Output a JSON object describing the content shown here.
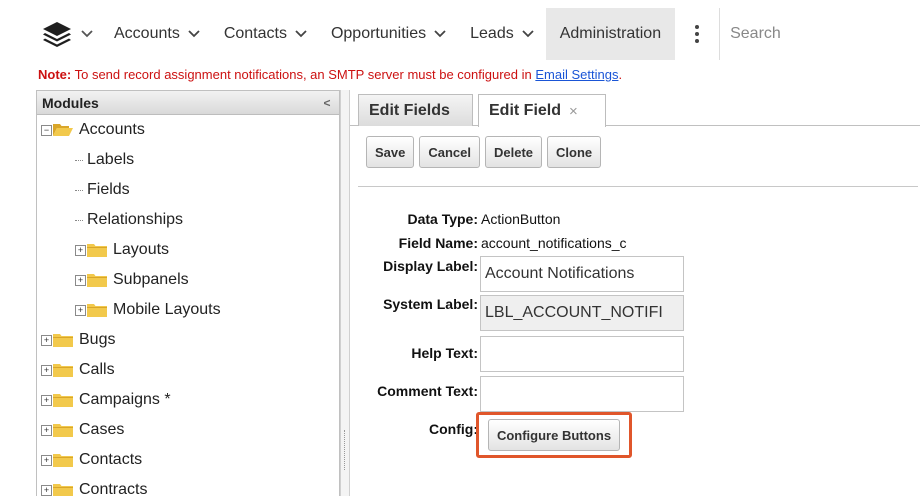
{
  "nav": {
    "logo_icon": "layers-icon",
    "items": [
      {
        "label": "Accounts"
      },
      {
        "label": "Contacts"
      },
      {
        "label": "Opportunities"
      },
      {
        "label": "Leads"
      }
    ],
    "active_label": "Administration",
    "search_placeholder": "Search"
  },
  "note": {
    "prefix": "Note:",
    "text": " To send record assignment notifications, an SMTP server must be configured in ",
    "link": "Email Settings",
    "suffix": "."
  },
  "modules": {
    "header": "Modules",
    "collapse_glyph": "<",
    "tree": [
      {
        "label": "Accounts",
        "kind": "folder-open",
        "expander": "−"
      },
      {
        "label": "Labels",
        "kind": "leaf"
      },
      {
        "label": "Fields",
        "kind": "leaf"
      },
      {
        "label": "Relationships",
        "kind": "leaf"
      },
      {
        "label": "Layouts",
        "kind": "folder",
        "expander": "+"
      },
      {
        "label": "Subpanels",
        "kind": "folder",
        "expander": "+"
      },
      {
        "label": "Mobile Layouts",
        "kind": "folder",
        "expander": "+"
      },
      {
        "label": "Bugs",
        "kind": "folder",
        "expander": "+"
      },
      {
        "label": "Calls",
        "kind": "folder",
        "expander": "+"
      },
      {
        "label": "Campaigns *",
        "kind": "folder",
        "expander": "+"
      },
      {
        "label": "Cases",
        "kind": "folder",
        "expander": "+"
      },
      {
        "label": "Contacts",
        "kind": "folder",
        "expander": "+"
      },
      {
        "label": "Contracts",
        "kind": "folder",
        "expander": "+"
      }
    ]
  },
  "tabs": {
    "inactive": "Edit Fields",
    "active": "Edit Field",
    "close_glyph": "×"
  },
  "toolbar": {
    "save": "Save",
    "cancel": "Cancel",
    "delete": "Delete",
    "clone": "Clone"
  },
  "form": {
    "data_type_label": "Data Type:",
    "data_type_value": "ActionButton",
    "field_name_label": "Field Name:",
    "field_name_value": "account_notifications_c",
    "display_label_label": "Display Label:",
    "display_label_value": "Account Notifications",
    "system_label_label": "System Label:",
    "system_label_value": "LBL_ACCOUNT_NOTIFI",
    "help_text_label": "Help Text:",
    "help_text_value": "",
    "comment_text_label": "Comment Text:",
    "comment_text_value": "",
    "config_label": "Config:",
    "config_button": "Configure Buttons"
  },
  "colors": {
    "note_red": "#cc1111",
    "link_blue": "#1a55d6",
    "highlight_orange": "#e0562b",
    "active_nav_bg": "#e8e8e8"
  }
}
